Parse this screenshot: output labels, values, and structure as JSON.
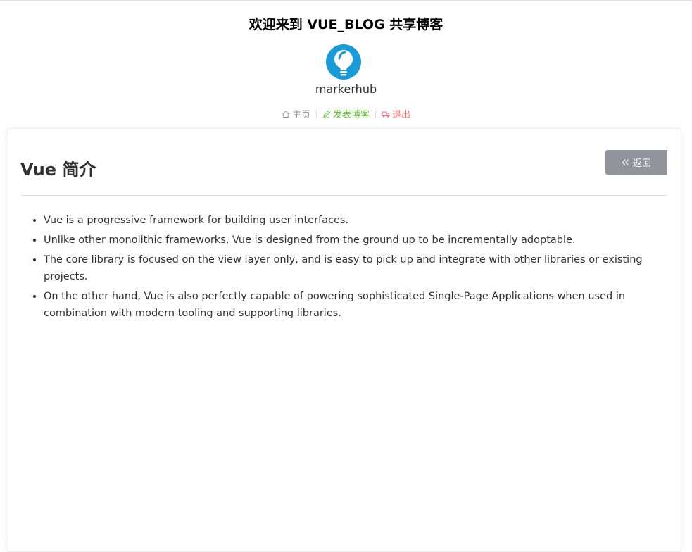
{
  "header": {
    "site_title": "欢迎来到 VUE_BLOG 共享博客",
    "avatar_icon": "lightbulb-avatar-icon",
    "username": "markerhub"
  },
  "nav": {
    "home_label": "主页",
    "home_icon": "house-icon",
    "post_label": "发表博客",
    "post_icon": "pen-icon",
    "logout_label": "退出",
    "logout_icon": "truck-icon",
    "colors": {
      "home": "#909399",
      "post": "#67c23a",
      "logout": "#f56c6c"
    }
  },
  "post": {
    "title": "Vue 简介",
    "back_label": "返回",
    "back_icon": "double-chevron-left-icon",
    "items": [
      "Vue is a progressive framework for building user interfaces.",
      "Unlike other monolithic frameworks, Vue is designed from the ground up to be incrementally adoptable.",
      "The core library is focused on the view layer only, and is easy to pick up and integrate with other libraries or existing projects.",
      "On the other hand, Vue is also perfectly capable of powering sophisticated Single-Page Applications when used in combination with modern tooling and supporting libraries."
    ]
  }
}
